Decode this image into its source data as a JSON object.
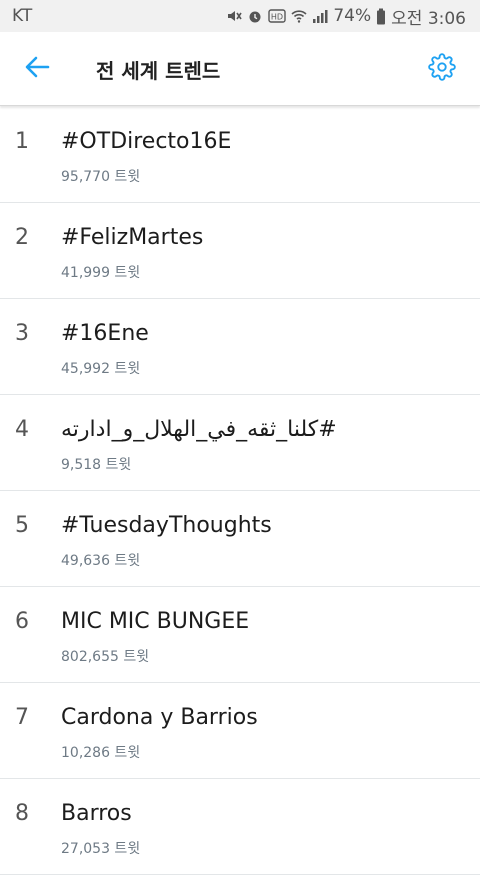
{
  "status": {
    "carrier": "KT",
    "battery": "74%",
    "time": "오전 3:06",
    "icons": [
      "mute-icon",
      "alarm-icon",
      "hd-icon",
      "wifi-icon",
      "signal-icon",
      "battery-icon"
    ]
  },
  "appbar": {
    "title": "전 세계 트렌드",
    "back_icon": "back-arrow-icon",
    "settings_icon": "gear-icon"
  },
  "colors": {
    "accent": "#1da1f2",
    "divider": "#e3e6e8",
    "count_text": "#6e7a85"
  },
  "trends": [
    {
      "rank": "1",
      "name": "#OTDirecto16E",
      "count": "95,770 트윗"
    },
    {
      "rank": "2",
      "name": "#FelizMartes",
      "count": "41,999 트윗"
    },
    {
      "rank": "3",
      "name": "#16Ene",
      "count": "45,992 트윗"
    },
    {
      "rank": "4",
      "name": "#كلنا_ثقه_في_الهلال_و_ادارته",
      "count": "9,518 트윗"
    },
    {
      "rank": "5",
      "name": "#TuesdayThoughts",
      "count": "49,636 트윗"
    },
    {
      "rank": "6",
      "name": "MIC MIC BUNGEE",
      "count": "802,655 트윗"
    },
    {
      "rank": "7",
      "name": "Cardona y Barrios",
      "count": "10,286 트윗"
    },
    {
      "rank": "8",
      "name": "Barros",
      "count": "27,053 트윗"
    }
  ]
}
